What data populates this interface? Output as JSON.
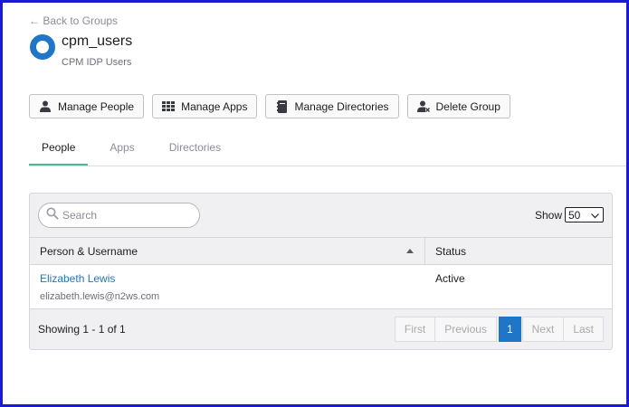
{
  "header": {
    "back_link": "← Back to Groups",
    "group_name": "cpm_users",
    "group_description": "CPM IDP Users",
    "brand_color": "#1f75c6"
  },
  "actions": [
    {
      "label": "Manage People",
      "icon": "person-icon"
    },
    {
      "label": "Manage Apps",
      "icon": "grid-icon"
    },
    {
      "label": "Manage Directories",
      "icon": "directory-icon"
    },
    {
      "label": "Delete Group",
      "icon": "remove-person-icon"
    }
  ],
  "tabs": [
    {
      "label": "People",
      "active": true
    },
    {
      "label": "Apps",
      "active": false
    },
    {
      "label": "Directories",
      "active": false
    }
  ],
  "table": {
    "search_placeholder": "Search",
    "show_label": "Show",
    "page_size": "50",
    "columns": [
      "Person & Username",
      "Status"
    ],
    "rows": [
      {
        "name": "Elizabeth Lewis",
        "email": "elizabeth.lewis@n2ws.com",
        "status": "Active"
      }
    ],
    "footer": "Showing 1 - 1 of 1",
    "pagination": {
      "first": "First",
      "previous": "Previous",
      "current": "1",
      "next": "Next",
      "last": "Last"
    }
  },
  "colors": {
    "accent": "#1f75c6",
    "tab_active": "#4cb89a",
    "frame": "#1a1ad6"
  }
}
